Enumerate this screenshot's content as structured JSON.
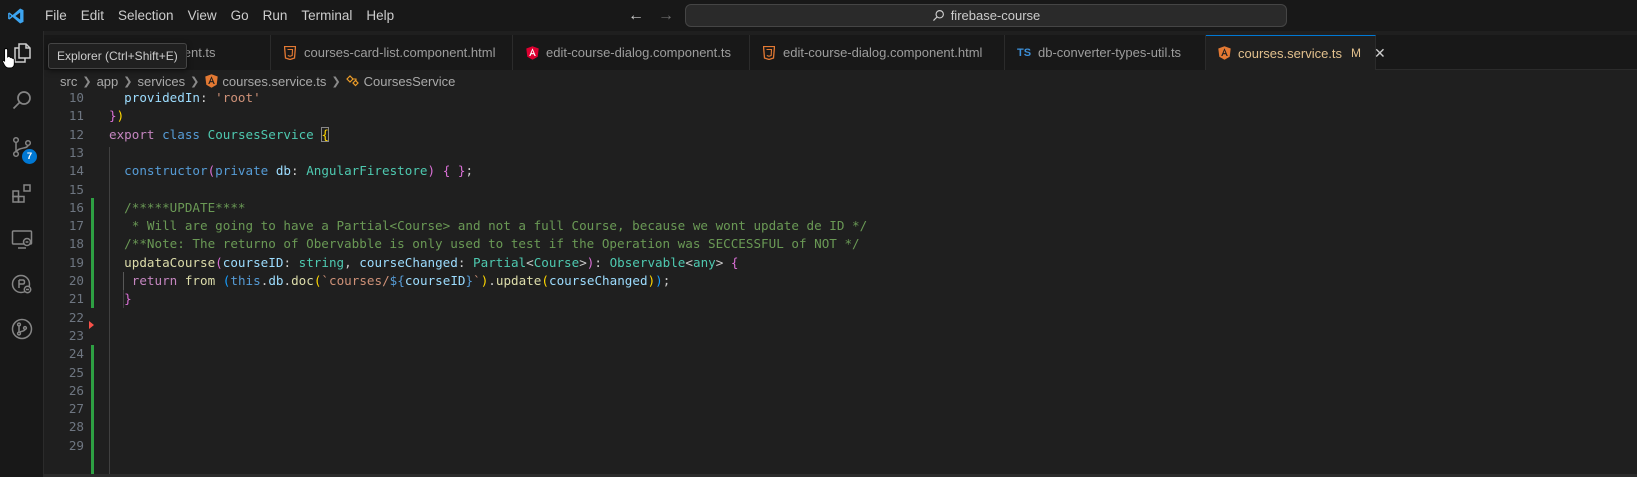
{
  "titlebar": {
    "menu": [
      "File",
      "Edit",
      "Selection",
      "View",
      "Go",
      "Run",
      "Terminal",
      "Help"
    ],
    "search_text": "firebase-course"
  },
  "activity_bar": {
    "items": [
      "explorer-icon",
      "search-icon",
      "source-control-icon",
      "extensions-icon",
      "remote-explorer-icon",
      "accounts-icon",
      "git-graph-icon"
    ],
    "source_control_badge": "7"
  },
  "tooltip": "Explorer (Ctrl+Shift+E)",
  "tabs": [
    {
      "label": "courses-card-list.component.ts",
      "visible_label": "omponent.ts",
      "icon": "angular-icon"
    },
    {
      "label": "courses-card-list.component.html",
      "icon": "html-icon"
    },
    {
      "label": "edit-course-dialog.component.ts",
      "icon": "angular-icon"
    },
    {
      "label": "edit-course-dialog.component.html",
      "icon": "html-icon"
    },
    {
      "label": "db-converter-types-util.ts",
      "icon": "ts-icon",
      "icon_text": "TS"
    },
    {
      "label": "courses.service.ts",
      "icon": "angular-icon",
      "modified": "M",
      "active": true
    }
  ],
  "breadcrumb": {
    "parts": [
      "src",
      "app",
      "services",
      "courses.service.ts",
      "CoursesService"
    ]
  },
  "editor": {
    "line_numbers": [
      "10",
      "11",
      "12",
      "13",
      "14",
      "15",
      "16",
      "17",
      "18",
      "19",
      "20",
      "21",
      "22",
      "23",
      "24",
      "25",
      "26",
      "27",
      "28",
      "29"
    ],
    "lines": [
      "  providedIn: 'root'",
      "})",
      "export class CoursesService {",
      "",
      "  constructor(private db: AngularFirestore) { };",
      "",
      "  /*****UPDATE****",
      "   * Will are going to have a Partial<Course> and not a full Course, because we wont update de ID */",
      "  /**Note: The returno of Obervabble is only used to test if the Operation was SECCESSFUL of NOT */",
      "  updataCourse(courseID: string, courseChanged: Partial<Course>): Observable<any> {",
      "   return from (this.db.doc(`courses/${courseID}`).update(courseChanged));",
      "  }",
      "",
      "",
      "",
      "",
      "",
      "",
      "",
      ""
    ]
  },
  "colors": {
    "keyword": "#569cd6",
    "control_keyword": "#c586c0",
    "class": "#4ec9b0",
    "function": "#dcdcaa",
    "variable": "#9cdcfe",
    "string": "#ce9178",
    "comment": "#6a9955",
    "active_tab_text": "#e2c08d",
    "gutter_added": "#2ea043",
    "badge": "#0078d4"
  }
}
